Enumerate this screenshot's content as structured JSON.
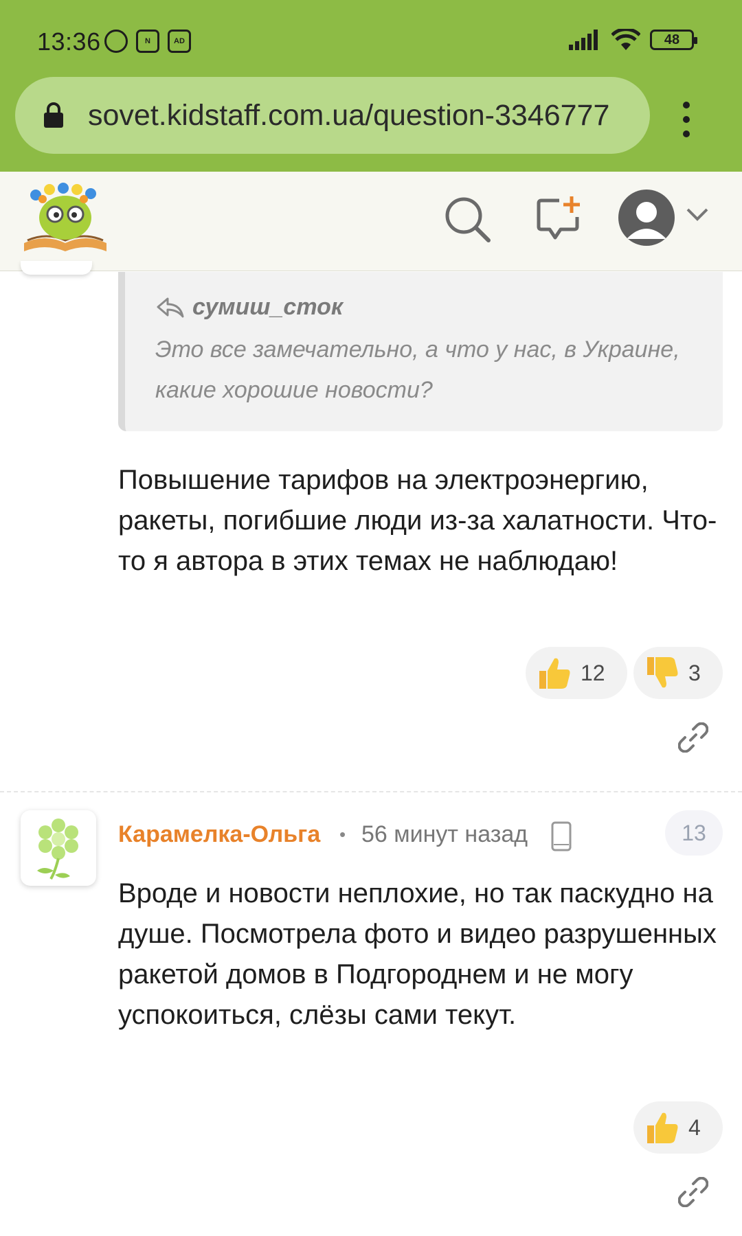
{
  "status_bar": {
    "time": "13:36",
    "battery": "48",
    "adblock_label": "AD"
  },
  "browser": {
    "url": "sovet.kidstaff.com.ua/question-3346777"
  },
  "header": {
    "logo": "kidstaff-logo",
    "icons": [
      "search-icon",
      "new-message-icon",
      "user-avatar-icon",
      "chevron-down-icon"
    ]
  },
  "comments": [
    {
      "quote": {
        "author": "сумиш_сток",
        "text": "Это все замечательно, а что у нас, в Украине, какие хорошие новости?"
      },
      "text": "Повышение тарифов на электроэнергию, ракеты, погибшие люди из-за халатности. Что-то я автора в этих темах не наблюдаю!",
      "likes": "12",
      "dislikes": "3"
    },
    {
      "author": "Карамелка-Ольга",
      "separator": "•",
      "time": "56 минут назад",
      "number": "13",
      "text": "Вроде и новости неплохие, но так паскудно на душе. Посмотрела фото и видео разрушенных ракетой домов в Подгороднем и не могу успокоиться, слёзы сами текут.",
      "likes": "4"
    }
  ],
  "colors": {
    "browser_chrome": "#8dbb45",
    "url_bar": "#b8d98a",
    "author_name": "#e8822a",
    "reaction_bg": "#f2f2f2"
  }
}
